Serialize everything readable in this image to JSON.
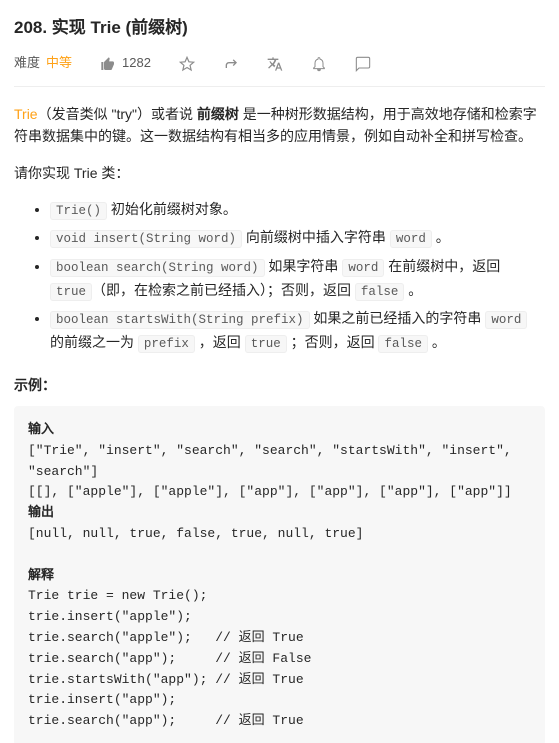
{
  "header": {
    "title": "208. 实现 Trie (前缀树)",
    "difficulty_label": "难度",
    "difficulty_value": "中等",
    "likes": "1282"
  },
  "desc": {
    "trie_word": "Trie",
    "pronunciation": "（发音类似 \"try\"）或者说 ",
    "prefix_tree": "前缀树",
    "rest": " 是一种树形数据结构，用于高效地存储和检索字符串数据集中的键。这一数据结构有相当多的应用情景，例如自动补全和拼写检查。"
  },
  "prompt": "请你实现 Trie 类：",
  "bullets": [
    {
      "code": "Trie()",
      "after": " 初始化前缀树对象。"
    },
    {
      "code": "void insert(String word)",
      "after": " 向前缀树中插入字符串 ",
      "code2": "word",
      "after2": " 。"
    },
    {
      "code": "boolean search(String word)",
      "after": " 如果字符串 ",
      "code2": "word",
      "after2": " 在前缀树中，返回 ",
      "code3": "true",
      "after3": "（即，在检索之前已经插入）；否则，返回 ",
      "code4": "false",
      "after4": " 。"
    },
    {
      "code": "boolean startsWith(String prefix)",
      "after": " 如果之前已经插入的字符串 ",
      "code2": "word",
      "after2": " 的前缀之一为 ",
      "code3": "prefix",
      "after3": " ，返回 ",
      "code4": "true",
      "after4": " ；否则，返回 ",
      "code5": "false",
      "after5": " 。"
    }
  ],
  "example_label": "示例：",
  "code": {
    "input_label": "输入",
    "input_l1": "[\"Trie\", \"insert\", \"search\", \"search\", \"startsWith\", \"insert\", \"search\"]",
    "input_l2": "[[], [\"apple\"], [\"apple\"], [\"app\"], [\"app\"], [\"app\"], [\"app\"]]",
    "output_label": "输出",
    "output_l1": "[null, null, true, false, true, null, true]",
    "explain_label": "解释",
    "explain_lines": [
      "Trie trie = new Trie();",
      "trie.insert(\"apple\");",
      "trie.search(\"apple\");   // 返回 True",
      "trie.search(\"app\");     // 返回 False",
      "trie.startsWith(\"app\"); // 返回 True",
      "trie.insert(\"app\");",
      "trie.search(\"app\");     // 返回 True"
    ]
  }
}
